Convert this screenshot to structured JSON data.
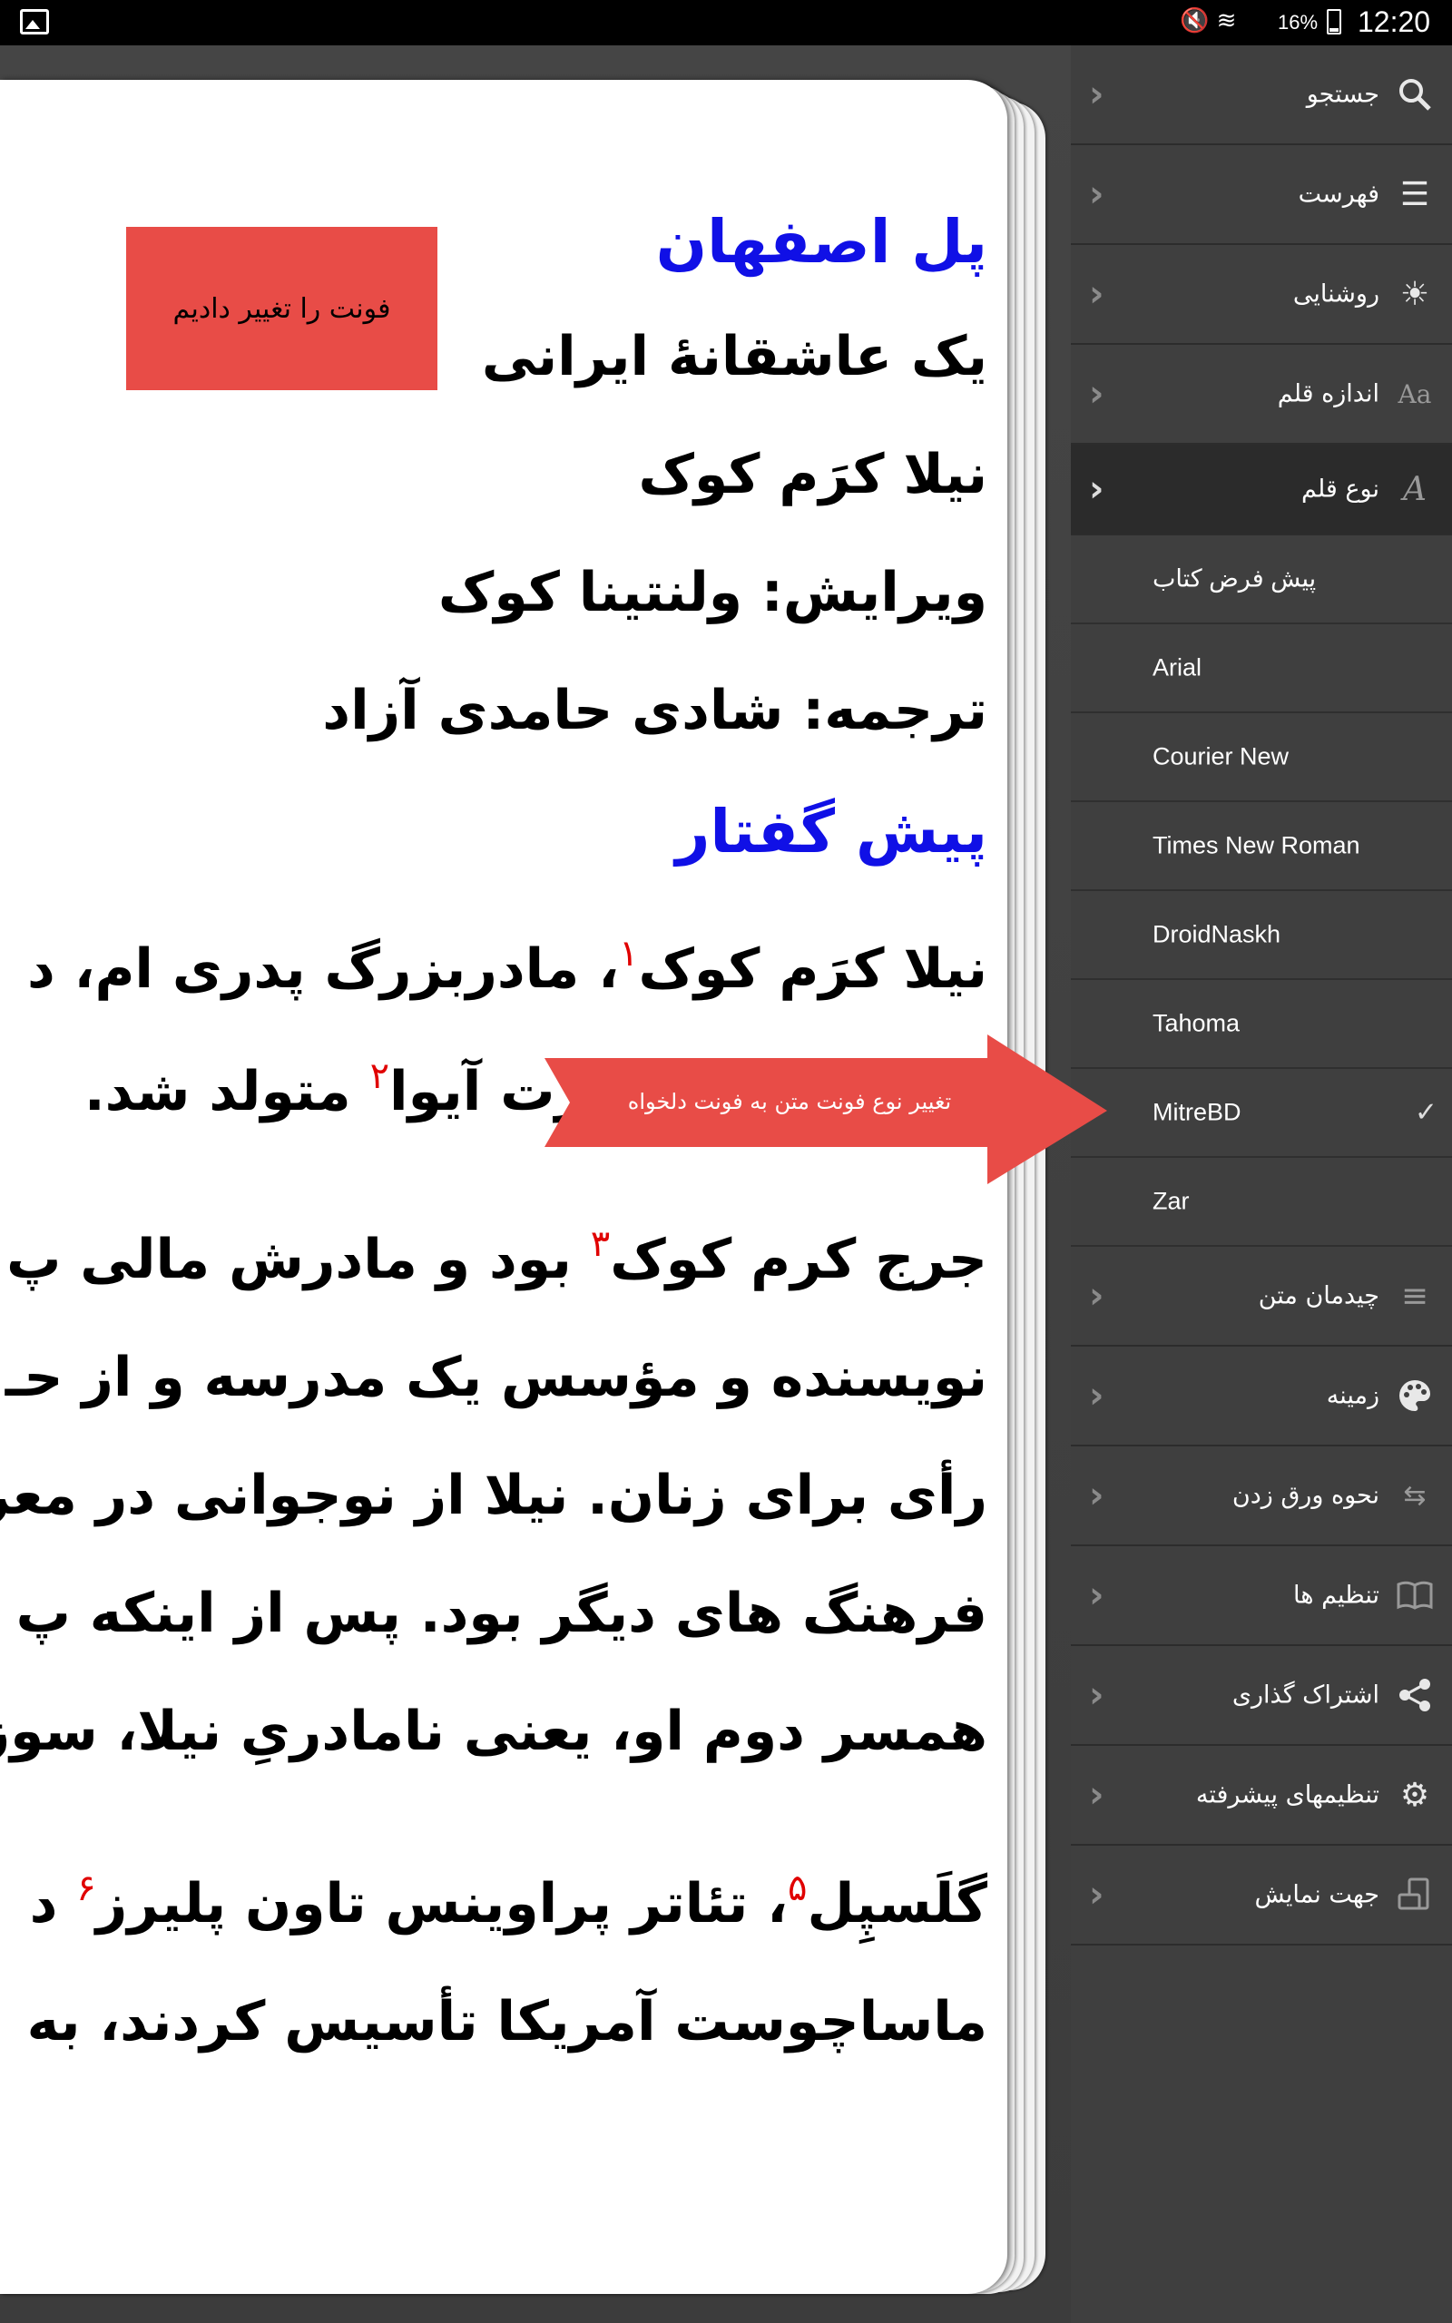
{
  "status_bar": {
    "battery": "16%",
    "time": "12:20"
  },
  "book": {
    "title": "پل اصفهان",
    "subtitle": "یک عاشقانۀ ایرانی",
    "author": "نیلا کرَم کوک",
    "editor": "ویرایش: ولنتینا کوک",
    "translator": "ترجمه: شادی حامدی آزاد",
    "section": "پیش گفتار",
    "paragraph1": [
      {
        "text": "نیلا کرَم کوک",
        "fn": "۱",
        "after": "، مادربزرگ پدری ام، د"
      },
      {
        "text": "۱۹۰۰ در دِیِن پورت آیوا",
        "fn": "۲",
        "after": " متولد شد."
      }
    ],
    "paragraph2": [
      {
        "text": "جرج کرم کوک",
        "fn": "۳",
        "after": " بود و مادرش مالی پ"
      },
      {
        "text": "نویسنده و مؤسس یک مدرسه و از حـ",
        "fn": "",
        "after": ""
      },
      {
        "text": "رأی برای زنان. نیلا از نوجوانی در معر",
        "fn": "",
        "after": ""
      },
      {
        "text": "فرهنگ های دیگر بود. پس از اینکه پ",
        "fn": "",
        "after": ""
      },
      {
        "text": "همسر دوم او، یعنی نامادریِ نیلا، سوز",
        "fn": "",
        "after": ""
      }
    ],
    "paragraph3": [
      {
        "text": "گلَسپِل",
        "fn": "۵",
        "after": "، تئاتر پراوینس تاون پلیرز",
        "fn2": "۶",
        "after2": " د"
      },
      {
        "text": "ماساچوست آمریکا تأسیس کردند، به",
        "fn": "",
        "after": ""
      }
    ]
  },
  "note_box": "فونت را تغییر دادیم",
  "callout": "تغییر نوع فونت متن به فونت دلخواه",
  "sidebar": {
    "items_top": [
      {
        "label": "جستجو",
        "icon": "search-icon"
      },
      {
        "label": "فهرست",
        "icon": "list-icon"
      },
      {
        "label": "روشنایی",
        "icon": "brightness-icon"
      },
      {
        "label": "اندازه قلم",
        "icon": "font-size-icon"
      },
      {
        "label": "نوع قلم",
        "icon": "font-type-icon"
      }
    ],
    "font_options": [
      {
        "label": "پیش فرض کتاب",
        "selected": false
      },
      {
        "label": "Arial",
        "selected": false
      },
      {
        "label": "Courier New",
        "selected": false
      },
      {
        "label": "Times New Roman",
        "selected": false
      },
      {
        "label": "DroidNaskh",
        "selected": false
      },
      {
        "label": "Tahoma",
        "selected": false
      },
      {
        "label": "MitreBD",
        "selected": true
      },
      {
        "label": "Zar",
        "selected": false
      }
    ],
    "check_mark": "✓",
    "items_bottom": [
      {
        "label": "چیدمان متن",
        "icon": "text-align-icon"
      },
      {
        "label": "زمینه",
        "icon": "palette-icon"
      },
      {
        "label": "نحوه ورق زدن",
        "icon": "page-turn-icon"
      },
      {
        "label": "تنظیم ها",
        "icon": "book-icon"
      },
      {
        "label": "اشتراک گذاری",
        "icon": "share-icon"
      },
      {
        "label": "تنظیمهای پیشرفته",
        "icon": "gear-icon"
      },
      {
        "label": "جهت نمایش",
        "icon": "orientation-icon"
      }
    ]
  },
  "colors": {
    "heading": "#1010e6",
    "footnote": "#e00000",
    "note_box": "#e84c47",
    "callout": "#e84c47"
  }
}
